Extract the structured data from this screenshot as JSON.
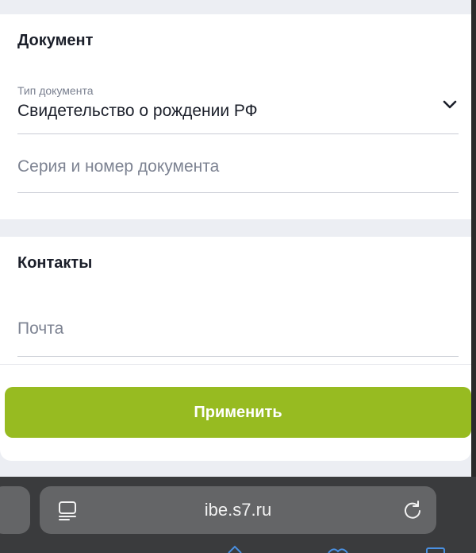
{
  "document_section": {
    "title": "Документ",
    "doc_type_label": "Тип документа",
    "doc_type_value": "Свидетельство о рождении РФ",
    "series_number_placeholder": "Серия и номер документа"
  },
  "contacts_section": {
    "title": "Контакты",
    "email_placeholder": "Почта"
  },
  "apply_button_label": "Применить",
  "browser": {
    "url": "ibe.s7.ru"
  },
  "colors": {
    "accent": "#97bb21",
    "page_background": "#eceef3",
    "text_primary": "#1b1f2a",
    "text_secondary": "#7d8392",
    "browser_chrome": "#3a3b3d"
  },
  "icons": {
    "dropdown": "chevron-down-icon",
    "reader": "reader-mode-icon",
    "reload": "reload-icon"
  }
}
